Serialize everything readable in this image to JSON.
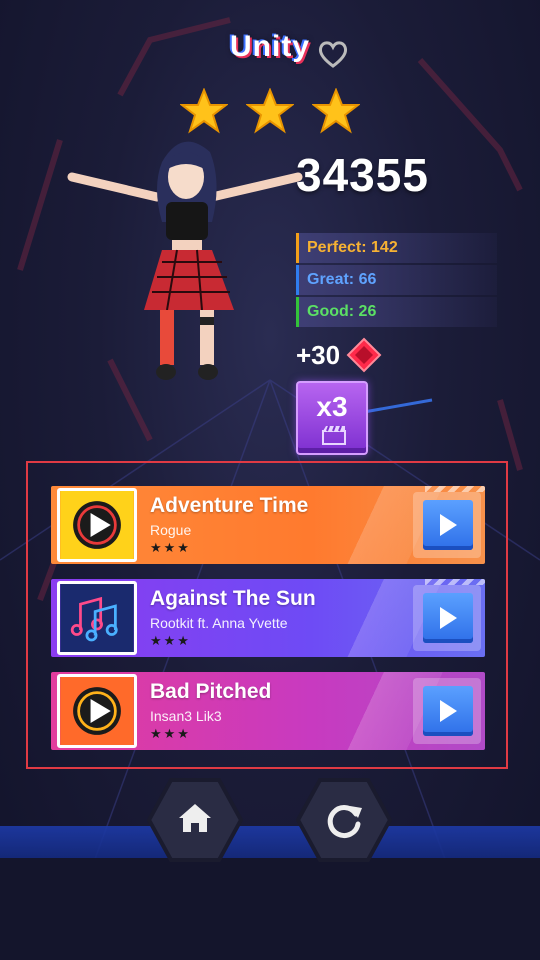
{
  "result": {
    "song_title": "Unity",
    "score": "34355",
    "stars_earned": 3,
    "stats": {
      "perfect": "Perfect: 142",
      "great": "Great: 66",
      "good": "Good: 26"
    },
    "reward": "+30",
    "multiplier": "x3"
  },
  "songs": [
    {
      "title": "Adventure Time",
      "artist": "Rogue",
      "rating": "★★★"
    },
    {
      "title": "Against The Sun",
      "artist": "Rootkit ft. Anna Yvette",
      "rating": "★★★"
    },
    {
      "title": "Bad Pitched",
      "artist": "Insan3 Lik3",
      "rating": "★★★"
    }
  ],
  "colors": {
    "perfect": "#f7b233",
    "great": "#5fa3ff",
    "good": "#5be064",
    "card_orange": "#ff8a3a",
    "card_purple": "#8b3cf0",
    "card_pink": "#e23c9d",
    "play_blue": "#3d84f5",
    "panel_border": "#e03a44"
  },
  "icons": {
    "heart": "heart-icon",
    "star": "star-icon",
    "gem": "gem-icon",
    "clapperboard": "clapperboard-icon",
    "play": "play-icon",
    "music_note": "music-note-icon",
    "home": "home-icon",
    "retry": "retry-icon"
  }
}
